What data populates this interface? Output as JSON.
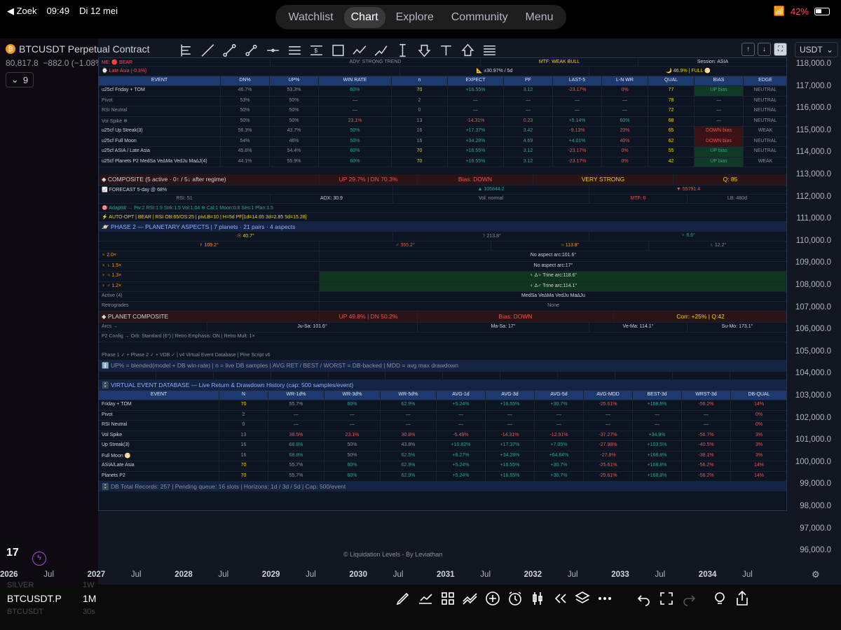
{
  "status": {
    "back": "◀ Zoek",
    "time": "09:49",
    "date": "Di 12 mei",
    "battery": "42%"
  },
  "nav": {
    "tabs": [
      "Watchlist",
      "Chart",
      "Explore",
      "Community",
      "Menu"
    ]
  },
  "symbol": {
    "name": "BTCUSDT Perpetual Contract",
    "coin": "₿",
    "price": "80,817.8",
    "change": "−882.0 (−1.08%)",
    "indicator_count": "9"
  },
  "currency": "USDT",
  "price_axis": [
    "118,000.0",
    "117,000.0",
    "116,000.0",
    "115,000.0",
    "114,000.0",
    "113,000.0",
    "112,000.0",
    "111,000.0",
    "110,000.0",
    "109,000.0",
    "108,000.0",
    "107,000.0",
    "106,000.0",
    "105,000.0",
    "104,000.0",
    "103,000.0",
    "102,000.0",
    "101,000.0",
    "100,000.0",
    "99,000.0",
    "98,000.0",
    "97,000.0",
    "96,000.0"
  ],
  "time_axis": [
    {
      "t": "2026",
      "yr": true
    },
    {
      "t": "Jul"
    },
    {
      "t": "2027",
      "yr": true
    },
    {
      "t": "Jul"
    },
    {
      "t": "2028",
      "yr": true
    },
    {
      "t": "Jul"
    },
    {
      "t": "2029",
      "yr": true
    },
    {
      "t": "Jul"
    },
    {
      "t": "2030",
      "yr": true
    },
    {
      "t": "Jul"
    },
    {
      "t": "2031",
      "yr": true
    },
    {
      "t": "Jul"
    },
    {
      "t": "2032",
      "yr": true
    },
    {
      "t": "Jul"
    },
    {
      "t": "2033",
      "yr": true
    },
    {
      "t": "Jul"
    },
    {
      "t": "2034",
      "yr": true
    },
    {
      "t": "Jul"
    }
  ],
  "watermark": "© Liquidation Levels - By Leviathan",
  "bottom": {
    "symbol": "BTCUSDT.P",
    "timeframe": "1M",
    "ghost1": "SILVER",
    "ghost2": "1W",
    "ghost3": "BTCUSDT",
    "ghost4": "30s"
  },
  "panel": {
    "top1": [
      "ME: 🔴 BEAR",
      "ADV: STRONG TREND",
      "MTF: WEAK BULL",
      "Session: ASIA"
    ],
    "top2": [
      "⌚ Late Asia  (-0.3%)",
      "📐 ±30.97% / 5d",
      "🌙 46.9% | FULL 🌕"
    ],
    "evt_headers": [
      "EVENT",
      "DN%",
      "UP%",
      "WIN RATE",
      "n",
      "EXPECT",
      "PF",
      "LAST-5",
      "L-N WR",
      "QUAL",
      "BIAS",
      "EDGE"
    ],
    "evt_rows": [
      [
        "u25cf Friday + TOM",
        "46.7%",
        "53.3%",
        "60%",
        "70",
        "+16.55%",
        "3.12",
        "-23.17%",
        "0%",
        "77",
        "UP bias",
        "NEUTRAL"
      ],
      [
        "Pivot",
        "53%",
        "50%",
        "—",
        "2",
        "—",
        "—",
        "—",
        "—",
        "78",
        "—",
        "NEUTRAL"
      ],
      [
        "RSI Neutral",
        "50%",
        "50%",
        "—",
        "0",
        "—",
        "—",
        "—",
        "—",
        "72",
        "—",
        "NEUTRAL"
      ],
      [
        "Vol Spike ❄",
        "50%",
        "50%",
        "23.1%",
        "13",
        "-14.31%",
        "0.23",
        "+5.14%",
        "60%",
        "68",
        "—",
        "NEUTRAL"
      ],
      [
        "u25cf Up Streak(3)",
        "56.3%",
        "43.7%",
        "50%",
        "16",
        "+17.37%",
        "3.42",
        "-9.13%",
        "20%",
        "65",
        "DOWN bias",
        "WEAK"
      ],
      [
        "u25cf Full Moon",
        "54%",
        "46%",
        "50%",
        "16",
        "+34.28%",
        "4.69",
        "+4.01%",
        "40%",
        "62",
        "DOWN bias",
        "NEUTRAL"
      ],
      [
        "u25cf ASIA / Late Asia",
        "45.6%",
        "54.4%",
        "60%",
        "70",
        "+16.55%",
        "3.12",
        "-23.17%",
        "0%",
        "55",
        "UP bias",
        "NEUTRAL"
      ],
      [
        "u25cf Planets P2 MedSa Ve∆Ma VedJu Ma∆J(4)",
        "44.1%",
        "55.9%",
        "60%",
        "70",
        "+16.55%",
        "3.12",
        "-23.17%",
        "0%",
        "42",
        "UP bias",
        "WEAK"
      ]
    ],
    "composite": {
      "label": "◆ COMPOSITE  (5 active · 0↑ / 5↓ after regime)",
      "updn": "UP 29.7%  |  DN 70.3%",
      "bias": "Bias: DOWN",
      "strength": "VERY STRONG",
      "q": "Q: 85"
    },
    "forecast": {
      "label": "📈 FORECAST  5-day @ 68%",
      "up": "▲ 105844.2",
      "dn": "▼ 55791.4"
    },
    "stats": [
      "RSI: 51",
      "ADX: 30.9",
      "Vol: normal",
      "MTF: 0",
      "LB: 480d"
    ],
    "adapt": "🎯 AdaptW → Piv:2  RSI:1.9  Strk:1.5  Vol:1.04 ❄  Cal:1  Moon:0.8  Ses:1  Plan:1.5",
    "autoopt": "⚡ AUTO-OPT | BEAR | RSI OB:65/OS:25  |  pivLB=10  |  H=5d PF[1d=14.65 3d=2.85 5d=15.28]",
    "phase2": "🪐 PHASE 2 — PLANETARY ASPECTS  |  7 planets · 21 pairs · 4 aspects",
    "planets1": [
      "☉ 40.7°",
      "☽ 213.8°",
      "♀ 6.6°"
    ],
    "planets2": [
      "☿ 109.2°",
      "♂ 355.2°",
      "♃ 113.8°",
      "♄ 12.2°"
    ],
    "aspects": [
      {
        "w": "♃ 2.0×",
        "t": "No aspect  arc:101.6°",
        "trn": false
      },
      {
        "w": "♃ ♄  1.5×",
        "t": "No aspect  arc:17°",
        "trn": false
      },
      {
        "w": "♀ ♃  1.3×",
        "t": "♀ ∆♃ Trine  arc:118.6°",
        "trn": true
      },
      {
        "w": "♀ ♂   1.2×",
        "t": "♀ ∆♂ Trine  arc:114.1°",
        "trn": true
      }
    ],
    "active": {
      "label": "Active (4)",
      "val": "MedSa Ve∆Ma VedJu Ma∆Ju"
    },
    "retro": {
      "label": "Retrogrades",
      "val": "None"
    },
    "planet_comp": {
      "label": "◆ PLANET COMPOSITE",
      "updn": "UP 49.8%  |  DN 50.2%",
      "bias": "Bias: DOWN",
      "corr": "Corr: +25% | Q:42"
    },
    "arcs": [
      "Arcs →",
      "Ju-Sa: 101.6°",
      "Ma-Sa: 17°",
      "Ve-Ma: 114.1°",
      "Su-Mo: 173.1°"
    ],
    "p2config": "P2 Config → Orb: Standard (6°)  |  Retro Emphasis: ON  |  Retro Mult: 1×",
    "phasestatus": "Phase 1 ✓ + Phase 2 ✓ + VDB ✓  |  v4  Virtual Event Database  |  Pine Script v6",
    "legend": "ℹ️ UP% = blended(model + DB win-rate)  |  n = live DB samples  |  AVG RET / BEST / WORST = DB-backed  |  MDD = avg max drawdown",
    "vdb_title": "🗄️ VIRTUAL EVENT DATABASE  —  Live Return & Drawdown History  (cap: 500 samples/event)",
    "vdb_headers": [
      "EVENT",
      "N",
      "WR-1d%",
      "WR-3d%",
      "WR-5d%",
      "AVG-1d",
      "AVG-3d",
      "AVG-5d",
      "AVG-MDD",
      "BEST-3d",
      "WRST-3d",
      "DB-QUAL"
    ],
    "vdb_rows": [
      [
        "Friday + TOM",
        "70",
        "55.7%",
        "60%",
        "62.9%",
        "+5.24%",
        "+16.55%",
        "+30.7%",
        "-25.61%",
        "+168.8%",
        "-56.2%",
        "14%"
      ],
      [
        "Pivot",
        "2",
        "—",
        "—",
        "—",
        "—",
        "—",
        "—",
        "—",
        "—",
        "—",
        "0%"
      ],
      [
        "RSI Neutral",
        "0",
        "—",
        "—",
        "—",
        "—",
        "—",
        "—",
        "—",
        "—",
        "—",
        "0%"
      ],
      [
        "Vol Spike",
        "13",
        "38.5%",
        "23.1%",
        "30.8%",
        "-5.49%",
        "-14.31%",
        "-12.91%",
        "-37.27%",
        "+34.9%",
        "-56.7%",
        "3%"
      ],
      [
        "Up Streak(3)",
        "16",
        "68.8%",
        "50%",
        "43.8%",
        "+10.82%",
        "+17.37%",
        "+7.05%",
        "-27.98%",
        "+103.5%",
        "-40.5%",
        "3%"
      ],
      [
        "Full Moon 🌕",
        "16",
        "68.8%",
        "50%",
        "62.5%",
        "+8.27%",
        "+34.28%",
        "+64.84%",
        "-27.8%",
        "+168.8%",
        "-38.1%",
        "3%"
      ],
      [
        "ASIA/Late Asia",
        "70",
        "55.7%",
        "60%",
        "62.9%",
        "+5.24%",
        "+16.55%",
        "+30.7%",
        "-25.61%",
        "+168.8%",
        "-56.2%",
        "14%"
      ],
      [
        "Planets P2",
        "70",
        "55.7%",
        "60%",
        "62.9%",
        "+5.24%",
        "+16.55%",
        "+30.7%",
        "-25.61%",
        "+168.8%",
        "-56.2%",
        "14%"
      ]
    ],
    "db_footer": "🗄️ DB Total Records: 257  |  Pending queue: 16 slots  |  Horizons: 1d / 3d / 5d  |  Cap: 500/event"
  }
}
